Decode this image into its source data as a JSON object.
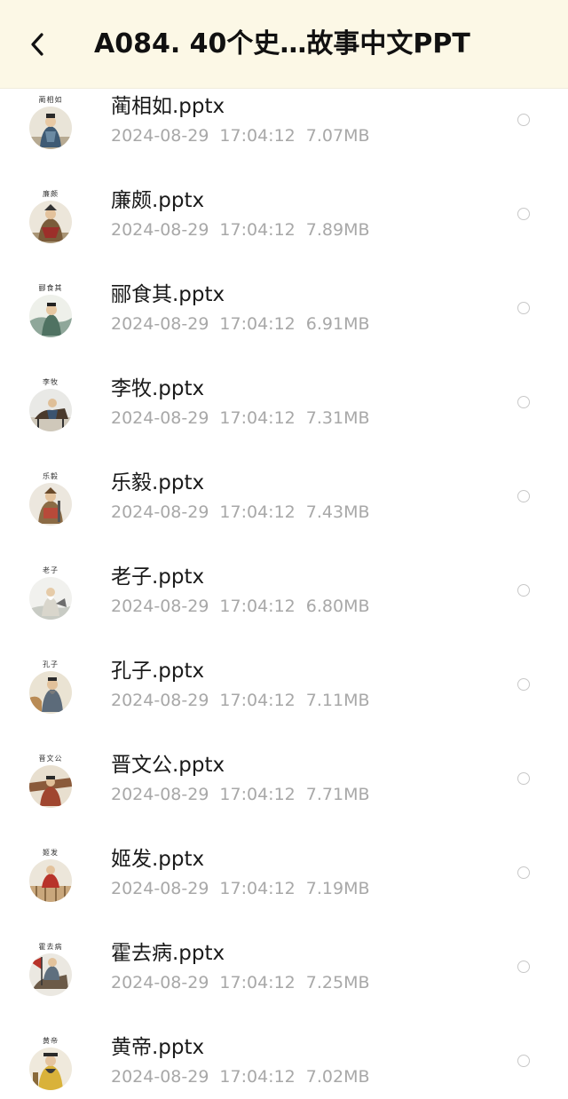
{
  "header": {
    "title": "A084. 40个史…故事中文PPT",
    "back_icon": "chevron-left-icon"
  },
  "files": [
    {
      "name": "蔺相如.pptx",
      "date": "2024-08-29",
      "time": "17:04:12",
      "size": "7.07MB",
      "thumb_caption": "蔺相如"
    },
    {
      "name": "廉颇.pptx",
      "date": "2024-08-29",
      "time": "17:04:12",
      "size": "7.89MB",
      "thumb_caption": "廉颇"
    },
    {
      "name": "郦食其.pptx",
      "date": "2024-08-29",
      "time": "17:04:12",
      "size": "6.91MB",
      "thumb_caption": "郦食其"
    },
    {
      "name": "李牧.pptx",
      "date": "2024-08-29",
      "time": "17:04:12",
      "size": "7.31MB",
      "thumb_caption": "李牧"
    },
    {
      "name": "乐毅.pptx",
      "date": "2024-08-29",
      "time": "17:04:12",
      "size": "7.43MB",
      "thumb_caption": "乐毅"
    },
    {
      "name": "老子.pptx",
      "date": "2024-08-29",
      "time": "17:04:12",
      "size": "6.80MB",
      "thumb_caption": "老子"
    },
    {
      "name": "孔子.pptx",
      "date": "2024-08-29",
      "time": "17:04:12",
      "size": "7.11MB",
      "thumb_caption": "孔子"
    },
    {
      "name": "晋文公.pptx",
      "date": "2024-08-29",
      "time": "17:04:12",
      "size": "7.71MB",
      "thumb_caption": "晋文公"
    },
    {
      "name": "姬发.pptx",
      "date": "2024-08-29",
      "time": "17:04:12",
      "size": "7.19MB",
      "thumb_caption": "姬发"
    },
    {
      "name": "霍去病.pptx",
      "date": "2024-08-29",
      "time": "17:04:12",
      "size": "7.25MB",
      "thumb_caption": "霍去病"
    },
    {
      "name": "黄帝.pptx",
      "date": "2024-08-29",
      "time": "17:04:12",
      "size": "7.02MB",
      "thumb_caption": "黄帝"
    }
  ],
  "colors": {
    "header_bg": "#fcf8e6",
    "title": "#111111",
    "filename": "#1a1a1a",
    "meta": "#a8a8a8",
    "radio_border": "#c8c8c8"
  }
}
